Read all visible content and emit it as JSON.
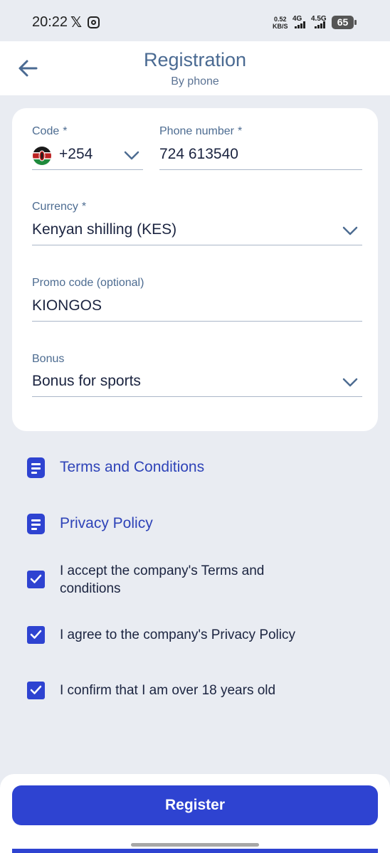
{
  "status_bar": {
    "time": "20:22",
    "x_glyph": "𝕏",
    "speed_value": "0.52",
    "speed_unit": "KB/S",
    "net1": "4G",
    "net2": "4.5G",
    "battery": "65"
  },
  "header": {
    "title": "Registration",
    "subtitle": "By phone",
    "back_icon": "arrow-left-icon"
  },
  "form": {
    "code": {
      "label": "Code",
      "value": "+254",
      "flag_icon": "kenya-flag-icon"
    },
    "phone": {
      "label": "Phone number",
      "value": "724 613540"
    },
    "required_mark": "*",
    "currency": {
      "label": "Currency",
      "value": "Kenyan shilling (KES)"
    },
    "promo": {
      "label": "Promo code (optional)",
      "value": "KIONGOS"
    },
    "bonus": {
      "label": "Bonus",
      "value": "Bonus for sports"
    }
  },
  "links": {
    "terms": "Terms and Conditions",
    "privacy": "Privacy Policy"
  },
  "checks": [
    {
      "line1": "I accept the company's Terms and",
      "line2": "conditions",
      "checked": true
    },
    {
      "line1": "I agree to the company's Privacy Policy",
      "checked": true
    },
    {
      "line1": "I confirm that I am over 18 years old",
      "checked": true
    }
  ],
  "register_label": "Register",
  "colors": {
    "accent": "#2e43d1",
    "title": "#4a6a92",
    "background": "#e9ecf2"
  }
}
